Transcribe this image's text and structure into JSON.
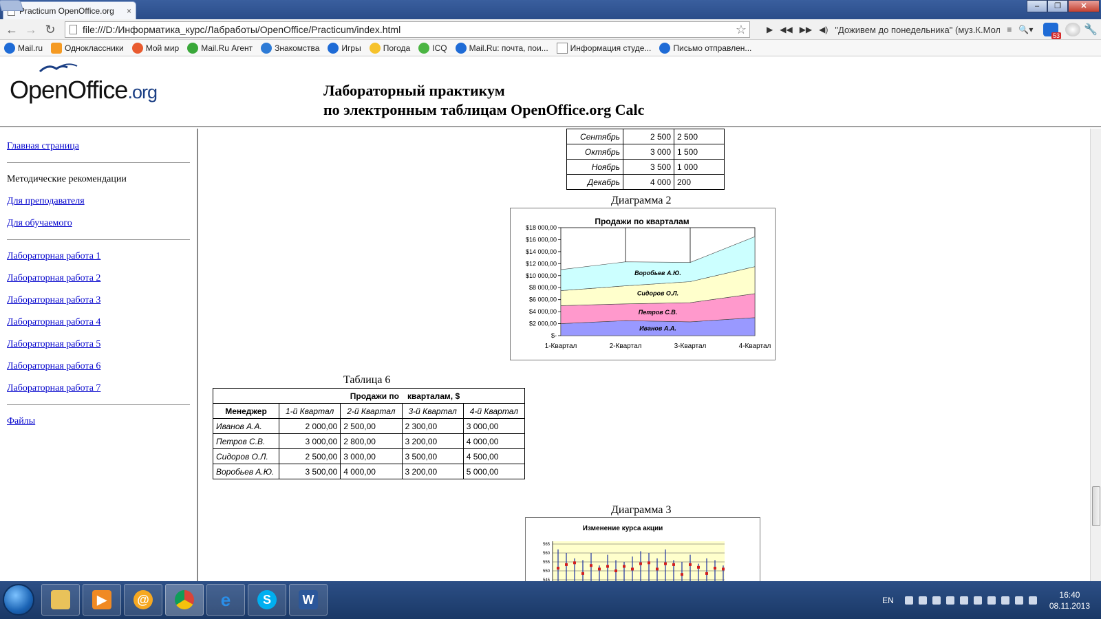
{
  "browser": {
    "tab_title": "Practicum OpenOffice.org",
    "tab_close": "×",
    "url": "file:///D:/Информатика_курс/Лабработы/OpenOffice/Practicum/index.html",
    "player_song": "\"Доживем до понедельника\" (муз.К.Молчан",
    "badge": "53",
    "bookmarks": [
      "Mail.ru",
      "Одноклассники",
      "Мой мир",
      "Mail.Ru Агент",
      "Знакомства",
      "Игры",
      "Погода",
      "ICQ",
      "Mail.Ru: почта, пои...",
      "Информация студе...",
      "Письмо отправлен..."
    ]
  },
  "header": {
    "logo_main": "OpenOffice",
    "logo_org": ".org",
    "title_line1": "Лабораторный практикум",
    "title_line2": "по электронным таблицам OpenOffice.org Calc"
  },
  "sidebar": {
    "home": "Главная страница",
    "methodical": "Методические рекомендации",
    "for_teacher": "Для преподавателя",
    "for_student": "Для обучаемого",
    "labs": [
      "Лабораторная работа 1",
      "Лабораторная работа 2",
      "Лабораторная работа 3",
      "Лабораторная работа 4",
      "Лабораторная работа 5",
      "Лабораторная работа 6",
      "Лабораторная работа 7"
    ],
    "files": "Файлы"
  },
  "month_table": {
    "rows": [
      [
        "Сентябрь",
        "2 500",
        "2 500"
      ],
      [
        "Октябрь",
        "3 000",
        "1 500"
      ],
      [
        "Ноябрь",
        "3 500",
        "1 000"
      ],
      [
        "Декабрь",
        "4 000",
        "200"
      ]
    ]
  },
  "diagram2": {
    "caption": "Диаграмма 2"
  },
  "table6": {
    "caption": "Таблица 6",
    "top_header_a": "Продажи по",
    "top_header_b": "кварталам, $",
    "headers": [
      "Менеджер",
      "1-й Квартал",
      "2-й Квартал",
      "3-й Квартал",
      "4-й Квартал"
    ],
    "rows": [
      [
        "Иванов А.А.",
        "2 000,00",
        "2 500,00",
        "2 300,00",
        "3 000,00"
      ],
      [
        "Петров С.В.",
        "3 000,00",
        "2 800,00",
        "3 200,00",
        "4 000,00"
      ],
      [
        "Сидоров О.Л.",
        "2 500,00",
        "3 000,00",
        "3 500,00",
        "4 500,00"
      ],
      [
        "Воробьев А.Ю.",
        "3 500,00",
        "4 000,00",
        "3 200,00",
        "5 000,00"
      ]
    ]
  },
  "diagram3": {
    "caption": "Диаграмма 3"
  },
  "chart_data": [
    {
      "type": "area",
      "stacked": true,
      "title": "Продажи по кварталам",
      "categories": [
        "1-Квартал",
        "2-Квартал",
        "3-Квартал",
        "4-Квартал"
      ],
      "y_ticks": [
        "$-",
        "$2 000,00",
        "$4 000,00",
        "$6 000,00",
        "$8 000,00",
        "$10 000,00",
        "$12 000,00",
        "$14 000,00",
        "$16 000,00",
        "$18 000,00"
      ],
      "ylim": [
        0,
        18000
      ],
      "series": [
        {
          "name": "Иванов А.А.",
          "values": [
            2000,
            2500,
            2300,
            3000
          ],
          "color": "#9999ff"
        },
        {
          "name": "Петров С.В.",
          "values": [
            3000,
            2800,
            3200,
            4000
          ],
          "color": "#ff99cc"
        },
        {
          "name": "Сидоров О.Л.",
          "values": [
            2500,
            3000,
            3500,
            4500
          ],
          "color": "#ffffcc"
        },
        {
          "name": "Воробьев А.Ю.",
          "values": [
            3500,
            4000,
            3200,
            5000
          ],
          "color": "#ccffff"
        }
      ]
    },
    {
      "type": "line",
      "title": "Изменение курса акции",
      "y_ticks": [
        "545",
        "550",
        "555",
        "560",
        "565"
      ],
      "ylim": [
        545,
        565
      ],
      "background": "#ffffcc"
    }
  ],
  "taskbar": {
    "lang": "EN",
    "time": "16:40",
    "date": "08.11.2013",
    "word_letter": "W"
  }
}
